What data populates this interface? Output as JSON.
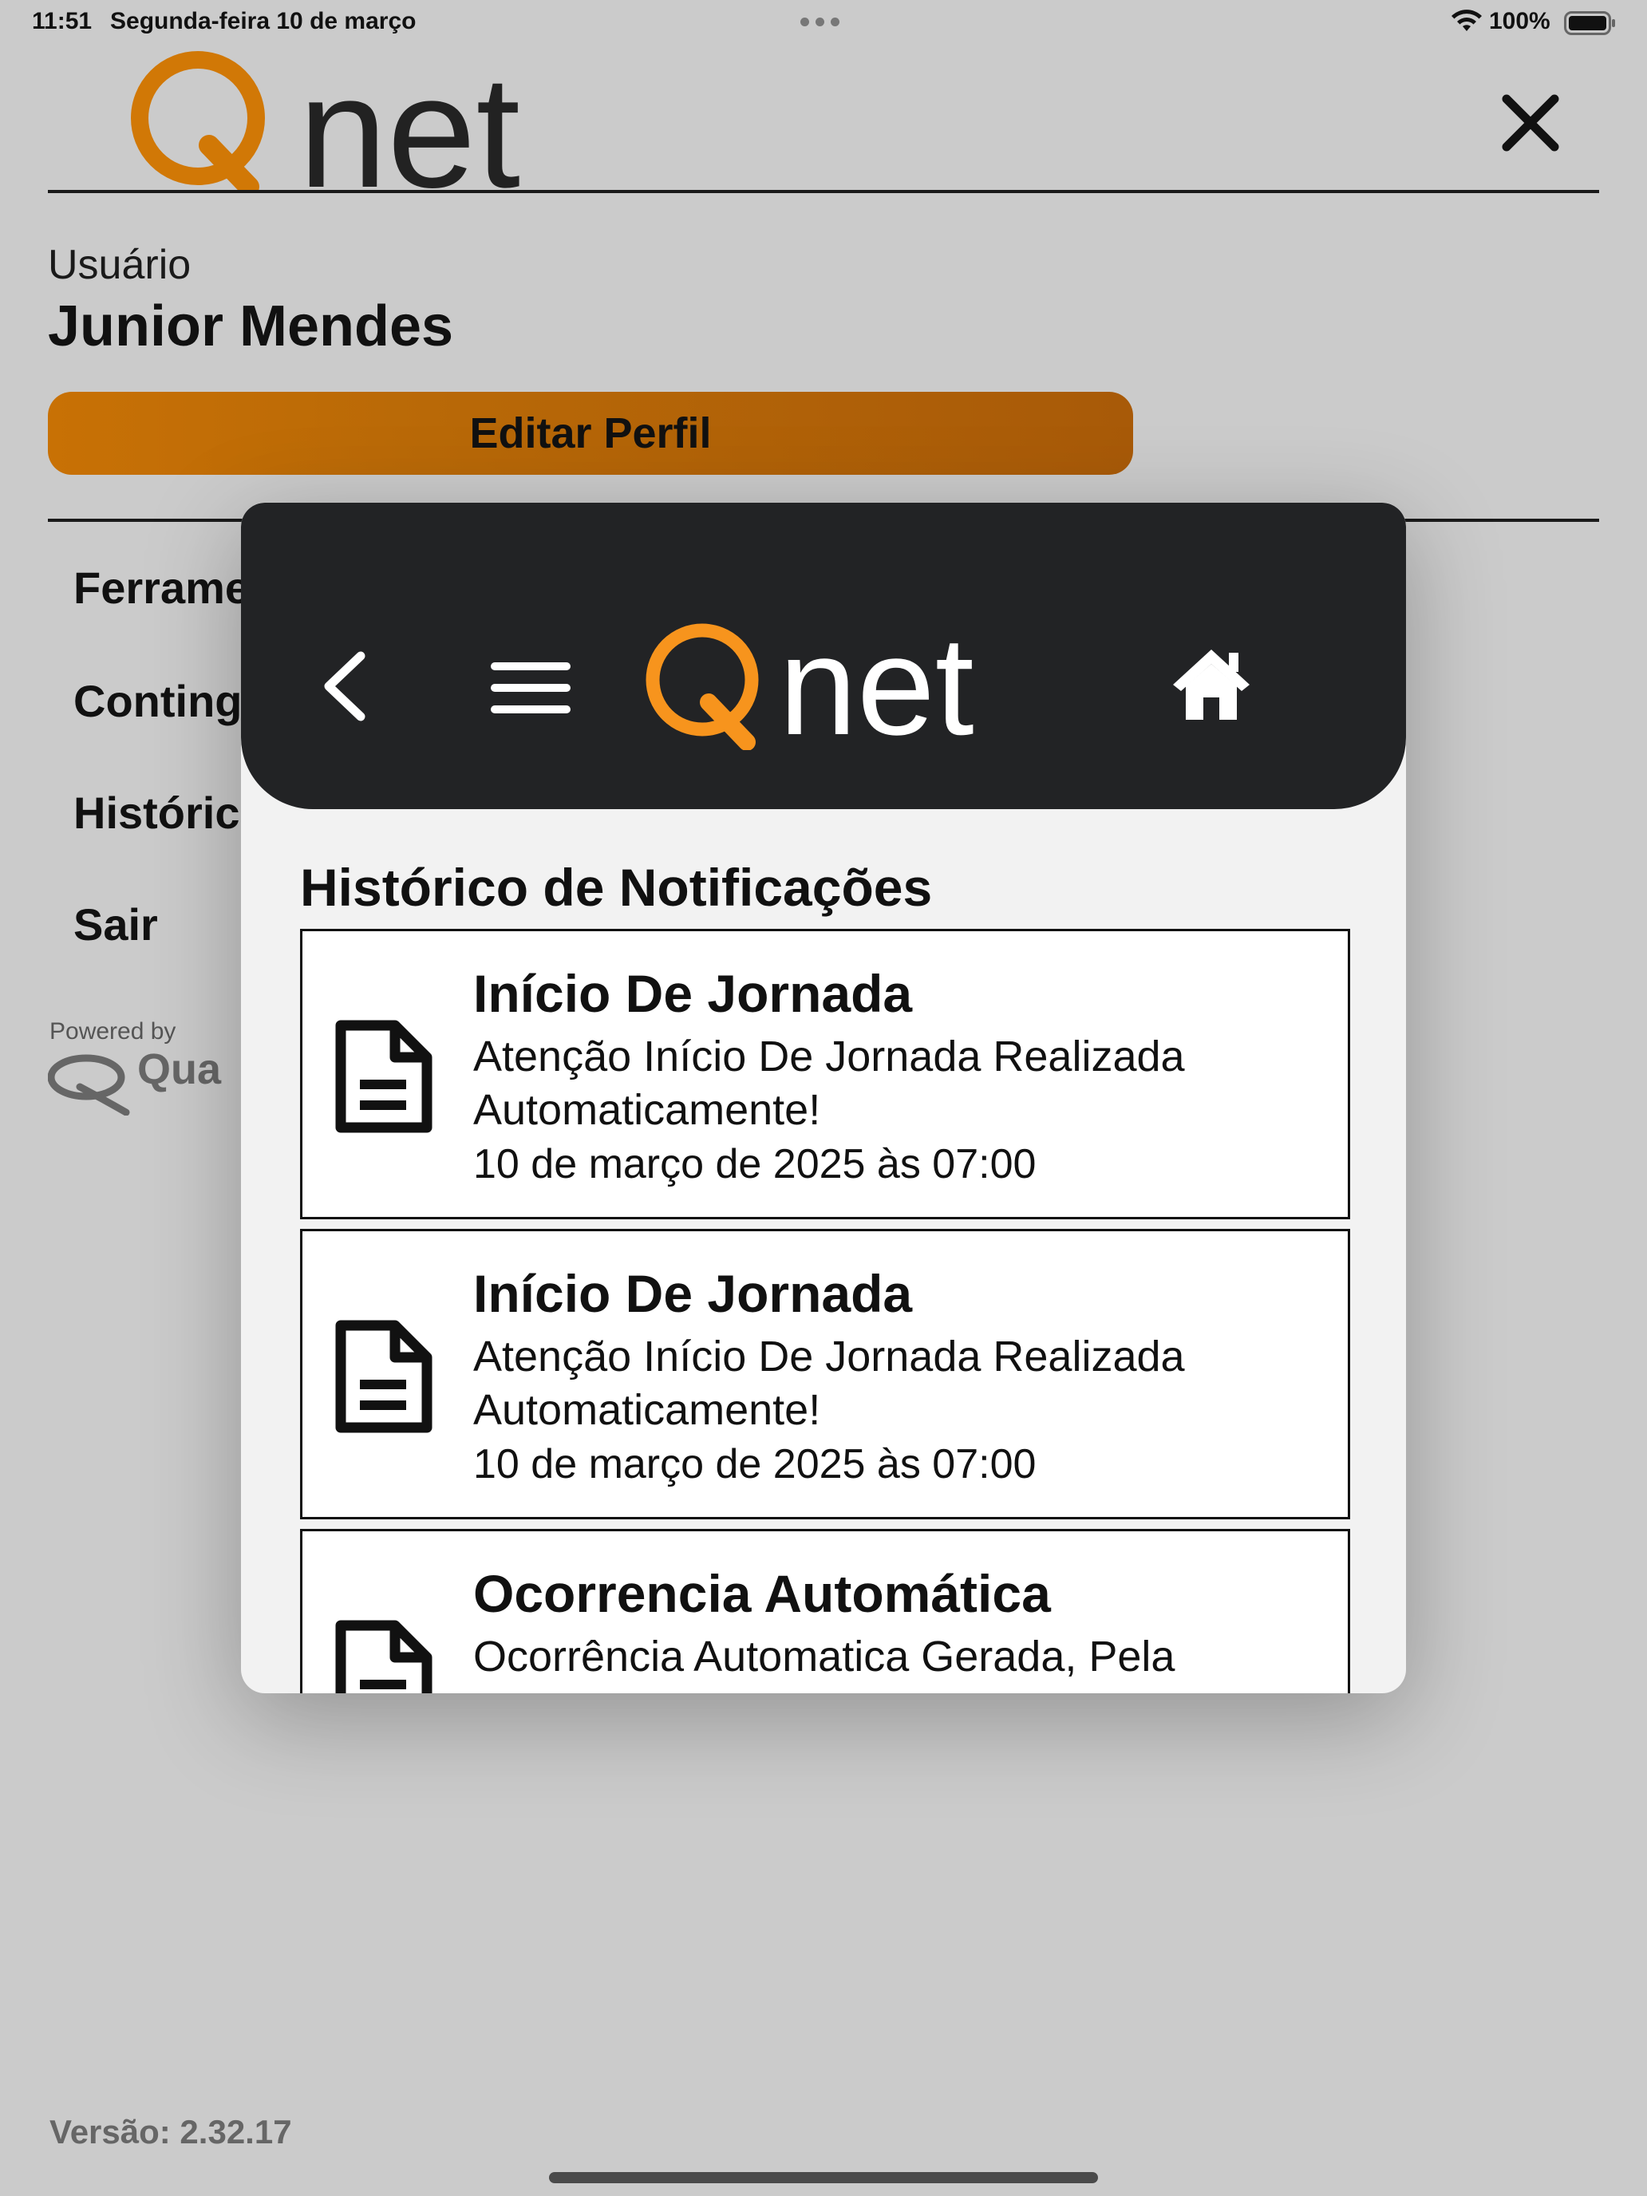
{
  "status_bar": {
    "time": "11:51",
    "date": "Segunda-feira 10 de março",
    "battery_pct": "100%",
    "icons": [
      "wifi-icon",
      "battery-icon",
      "more-dots-icon"
    ]
  },
  "profile": {
    "logo": "Qnet",
    "user_label": "Usuário",
    "user_name": "Junior Mendes",
    "edit_button": "Editar Perfil",
    "menu_items": [
      {
        "label": "Ferramentas",
        "visible": "Ferrame"
      },
      {
        "label": "Contingência",
        "visible": "Conting"
      },
      {
        "label": "Histórico",
        "visible": "Históric"
      },
      {
        "label": "Sair",
        "visible": "Sair"
      }
    ],
    "powered_by": "Powered by",
    "powered_logo": "Qua",
    "version": "Versão: 2.32.17"
  },
  "modal": {
    "logo": "Qnet",
    "title": "Histórico de Notificações",
    "notifications": [
      {
        "title": "Início De Jornada",
        "body": "Atenção Início De Jornada Realizada Automaticamente!",
        "date": "10 de março de 2025 às 07:00"
      },
      {
        "title": "Início De Jornada",
        "body": "Atenção Início De Jornada Realizada Automaticamente!",
        "date": "10 de março de 2025 às 07:00"
      },
      {
        "title": "Ocorrencia Automática",
        "body": "Ocorrência Automatica Gerada, Pela",
        "date": ""
      }
    ]
  },
  "colors": {
    "brand_orange": "#e8850e",
    "button_orange": "#b96907",
    "header_dark": "#222325",
    "overlay_bg": "#cbcbcb"
  }
}
